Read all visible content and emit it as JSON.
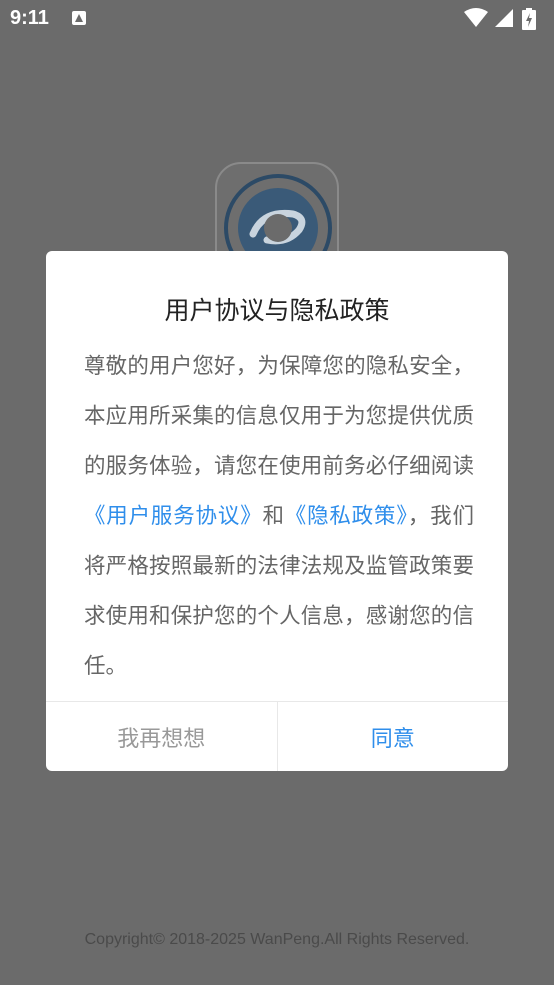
{
  "status_bar": {
    "time": "9:11",
    "icons": [
      "notification-icon",
      "wifi-icon",
      "signal-icon",
      "battery-icon"
    ]
  },
  "splash": {
    "logo_icon": "app-logo-icon",
    "copyright": "Copyright© 2018-2025 WanPeng.All Rights Reserved."
  },
  "dialog": {
    "title": "用户协议与隐私政策",
    "body": {
      "text_1": "尊敬的用户您好，为保障您的隐私安全，本应用所采集的信息仅用于为您提供优质的服务体验，请您在使用前务必仔细阅读",
      "link_1": "《用户服务协议》",
      "text_2": "和",
      "link_2": "《隐私政策》",
      "text_3": "，我们将严格按照最新的法律法规及监管政策要求使用和保护您的个人信息，感谢您的信任。"
    },
    "cancel_label": "我再想想",
    "agree_label": "同意"
  },
  "colors": {
    "overlay": "#6b6b6b",
    "accent": "#2f8eeb",
    "cancel_text": "#999999",
    "title_text": "#222222",
    "body_text": "#666666"
  }
}
